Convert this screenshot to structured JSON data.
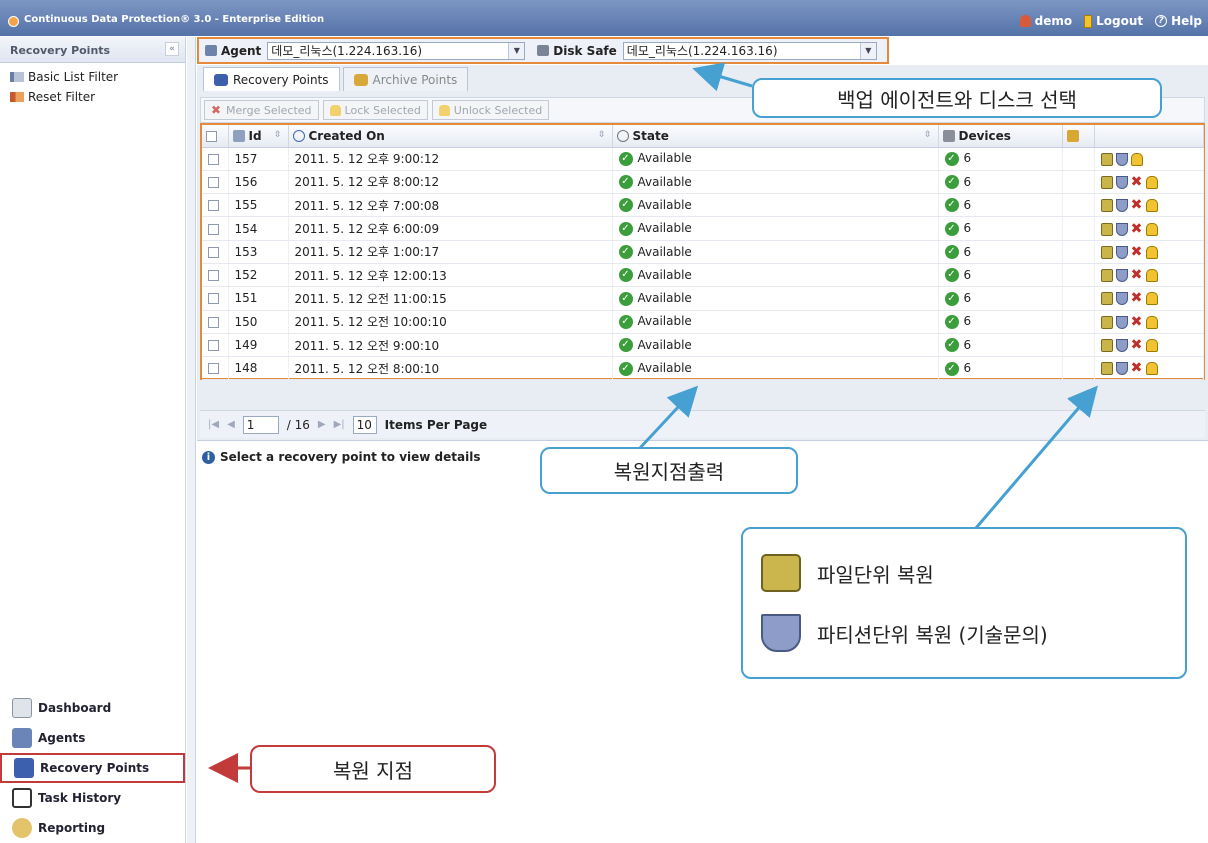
{
  "window": {
    "title": "Continuous Data Protection® 3.0 - Enterprise Edition",
    "user": "demo",
    "logout": "Logout",
    "help": "Help"
  },
  "sidebar": {
    "header": "Recovery Points",
    "collapse": "«",
    "filters": [
      "Basic List Filter",
      "Reset Filter"
    ],
    "nav": [
      "Dashboard",
      "Agents",
      "Recovery Points",
      "Task History",
      "Reporting"
    ]
  },
  "selectors": {
    "agent_label": "Agent",
    "agent_value": "데모_리눅스(1.224.163.16)",
    "disksafe_label": "Disk Safe",
    "disksafe_value": "데모_리눅스(1.224.163.16)"
  },
  "tabs": [
    "Recovery Points",
    "Archive Points"
  ],
  "toolbar": {
    "merge": "Merge Selected",
    "lock": "Lock Selected",
    "unlock": "Unlock Selected"
  },
  "grid": {
    "columns": [
      "Id",
      "Created On",
      "State",
      "Devices"
    ],
    "rows": [
      {
        "id": "157",
        "created": "2011. 5. 12 오후 9:00:12",
        "state": "Available",
        "devices": "6",
        "deletable": false
      },
      {
        "id": "156",
        "created": "2011. 5. 12 오후 8:00:12",
        "state": "Available",
        "devices": "6",
        "deletable": true
      },
      {
        "id": "155",
        "created": "2011. 5. 12 오후 7:00:08",
        "state": "Available",
        "devices": "6",
        "deletable": true
      },
      {
        "id": "154",
        "created": "2011. 5. 12 오후 6:00:09",
        "state": "Available",
        "devices": "6",
        "deletable": true
      },
      {
        "id": "153",
        "created": "2011. 5. 12 오후 1:00:17",
        "state": "Available",
        "devices": "6",
        "deletable": true
      },
      {
        "id": "152",
        "created": "2011. 5. 12 오후 12:00:13",
        "state": "Available",
        "devices": "6",
        "deletable": true
      },
      {
        "id": "151",
        "created": "2011. 5. 12 오전 11:00:15",
        "state": "Available",
        "devices": "6",
        "deletable": true
      },
      {
        "id": "150",
        "created": "2011. 5. 12 오전 10:00:10",
        "state": "Available",
        "devices": "6",
        "deletable": true
      },
      {
        "id": "149",
        "created": "2011. 5. 12 오전 9:00:10",
        "state": "Available",
        "devices": "6",
        "deletable": true
      },
      {
        "id": "148",
        "created": "2011. 5. 12 오전 8:00:10",
        "state": "Available",
        "devices": "6",
        "deletable": true
      }
    ]
  },
  "pager": {
    "page": "1",
    "total": "/ 16",
    "per_page": "10",
    "per_page_label": "Items Per Page"
  },
  "details_hint": "Select a recovery point to view details",
  "annotations": {
    "select_agent_disk": "백업 에이전트와 디스크 선택",
    "recovery_point_output": "복원지점출력",
    "file_restore": "파일단위 복원",
    "partition_restore": "파티션단위 복원 (기술문의)",
    "recovery_point": "복원 지점"
  },
  "colors": {
    "highlight_orange": "#e48a3a",
    "callout_blue": "#46a0d1",
    "callout_red": "#c23a3a"
  }
}
